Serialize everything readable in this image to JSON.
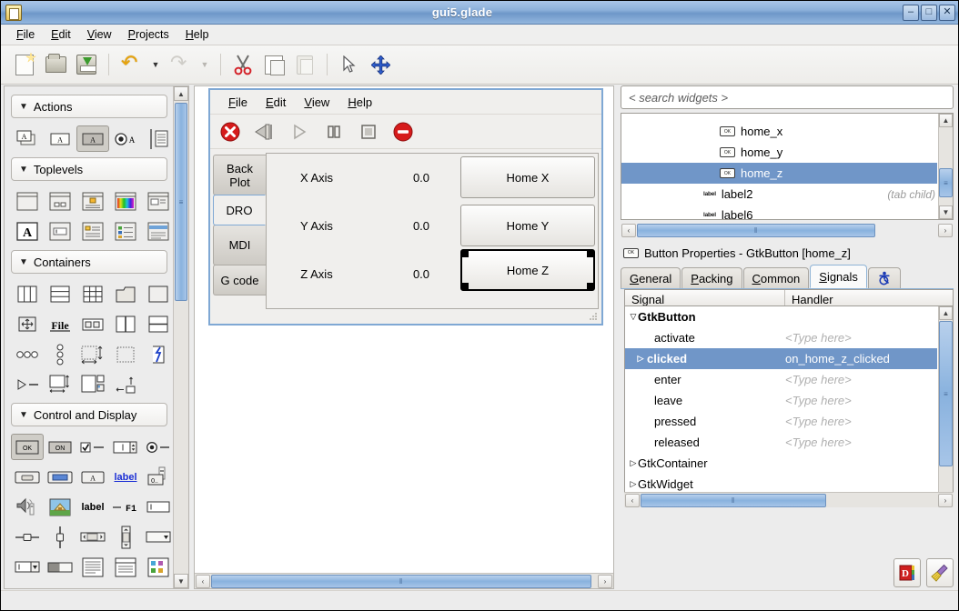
{
  "window": {
    "title": "gui5.glade",
    "icon": "glade-file-icon",
    "controls": {
      "minimize": "–",
      "maximize": "□",
      "close": "✕"
    }
  },
  "menubar": {
    "items": [
      {
        "label": "File",
        "mnemonic": "F"
      },
      {
        "label": "Edit",
        "mnemonic": "E"
      },
      {
        "label": "View",
        "mnemonic": "V"
      },
      {
        "label": "Projects",
        "mnemonic": "P"
      },
      {
        "label": "Help",
        "mnemonic": "H"
      }
    ]
  },
  "toolbar": {
    "buttons": [
      {
        "name": "new-project-icon",
        "title": "New"
      },
      {
        "name": "open-project-icon",
        "title": "Open"
      },
      {
        "name": "save-project-icon",
        "title": "Save"
      },
      {
        "name": "undo-icon",
        "title": "Undo"
      },
      {
        "name": "undo-dropdown-icon",
        "title": "Undo history"
      },
      {
        "name": "redo-icon",
        "title": "Redo"
      },
      {
        "name": "redo-dropdown-icon",
        "title": "Redo history"
      },
      {
        "name": "cut-icon",
        "title": "Cut"
      },
      {
        "name": "copy-icon",
        "title": "Copy"
      },
      {
        "name": "paste-icon",
        "title": "Paste"
      },
      {
        "name": "select-pointer-icon",
        "title": "Select"
      },
      {
        "name": "drag-resize-icon",
        "title": "Drag and Resize"
      }
    ]
  },
  "palette": {
    "groups": [
      {
        "label": "Actions",
        "expanded": true,
        "rows": [
          [
            {
              "name": "action-group-icon",
              "selected": false
            },
            {
              "name": "action-icon",
              "selected": false
            },
            {
              "name": "toggle-action-icon",
              "selected": true
            },
            {
              "name": "radio-action-icon",
              "selected": false
            },
            {
              "name": "recent-action-icon",
              "selected": false
            }
          ]
        ]
      },
      {
        "label": "Toplevels",
        "expanded": true,
        "rows": [
          [
            {
              "name": "window-icon",
              "selected": false
            },
            {
              "name": "dialog-icon",
              "selected": false
            },
            {
              "name": "message-dialog-icon",
              "selected": false
            },
            {
              "name": "color-selection-dialog-icon",
              "selected": false
            },
            {
              "name": "file-chooser-dialog-icon",
              "selected": false
            }
          ],
          [
            {
              "name": "font-selection-dialog-icon",
              "selected": false
            },
            {
              "name": "input-dialog-icon",
              "selected": false
            },
            {
              "name": "about-dialog-icon",
              "selected": false
            },
            {
              "name": "assistant-icon",
              "selected": false
            },
            {
              "name": "offscreen-window-icon",
              "selected": false
            }
          ]
        ]
      },
      {
        "label": "Containers",
        "expanded": true,
        "rows": [
          [
            {
              "name": "hbox-icon",
              "selected": false
            },
            {
              "name": "vbox-icon",
              "selected": false
            },
            {
              "name": "table-icon",
              "selected": false
            },
            {
              "name": "notebook-icon",
              "selected": false
            },
            {
              "name": "frame-icon",
              "selected": false
            }
          ],
          [
            {
              "name": "alignment-icon",
              "selected": false
            },
            {
              "name": "file-chooser-widget-icon",
              "selected": false
            },
            {
              "name": "hbutton-box-icon",
              "selected": false
            },
            {
              "name": "hpaned-icon",
              "selected": false
            },
            {
              "name": "vpaned-icon",
              "selected": false
            }
          ],
          [
            {
              "name": "vbutton-box-icon",
              "selected": false
            },
            {
              "name": "event-box-icon",
              "selected": false
            },
            {
              "name": "viewport-icon",
              "selected": false
            },
            {
              "name": "fixed-icon",
              "selected": false
            },
            {
              "name": "layout-icon",
              "selected": false
            }
          ],
          [
            {
              "name": "expander-icon",
              "selected": false
            },
            {
              "name": "scrolled-window-icon",
              "selected": false
            },
            {
              "name": "handle-box-icon",
              "selected": false
            },
            {
              "name": "toolbar-dock-icon",
              "selected": false
            },
            {
              "name": "spacer-icon",
              "selected": false
            }
          ]
        ]
      },
      {
        "label": "Control and Display",
        "expanded": true,
        "rows": [
          [
            {
              "name": "button-icon",
              "selected": true,
              "text": "OK"
            },
            {
              "name": "toggle-button-icon",
              "selected": false,
              "text": "ON"
            },
            {
              "name": "check-button-icon",
              "selected": false
            },
            {
              "name": "spin-button-icon",
              "selected": false
            },
            {
              "name": "radio-button-icon",
              "selected": false
            }
          ],
          [
            {
              "name": "file-chooser-button-icon",
              "selected": false
            },
            {
              "name": "color-button-icon",
              "selected": false
            },
            {
              "name": "font-button-icon",
              "selected": false
            },
            {
              "name": "link-button-icon",
              "selected": false,
              "text": "label"
            },
            {
              "name": "scale-button-icon",
              "selected": false,
              "text": "0.."
            }
          ],
          [
            {
              "name": "volume-button-icon",
              "selected": false
            },
            {
              "name": "image-icon",
              "selected": false
            },
            {
              "name": "label-icon",
              "selected": false,
              "text": "label"
            },
            {
              "name": "accel-label-icon",
              "selected": false,
              "text": "F1"
            },
            {
              "name": "entry-icon",
              "selected": false
            }
          ],
          [
            {
              "name": "hscale-icon",
              "selected": false
            },
            {
              "name": "vscale-icon",
              "selected": false
            },
            {
              "name": "hscrollbar-icon",
              "selected": false
            },
            {
              "name": "vscrollbar-icon",
              "selected": false
            },
            {
              "name": "combo-box-icon",
              "selected": false
            }
          ],
          [
            {
              "name": "combo-box-entry-icon",
              "selected": false
            },
            {
              "name": "progress-bar-icon",
              "selected": false
            },
            {
              "name": "text-view-icon",
              "selected": false
            },
            {
              "name": "tree-view-icon",
              "selected": false
            },
            {
              "name": "icon-view-icon",
              "selected": false
            }
          ],
          [
            {
              "name": "status-bar-icon",
              "selected": false
            },
            {
              "name": "toolbar-icon",
              "selected": false
            },
            {
              "name": "calendar-icon",
              "selected": false
            },
            {
              "name": "menu-bar-icon",
              "selected": false
            },
            {
              "name": "separator-icon",
              "selected": false
            }
          ]
        ]
      }
    ],
    "scrollbar": {
      "up": "▲",
      "down": "▼",
      "grip": "≡"
    }
  },
  "design": {
    "mock_window": {
      "menubar": [
        {
          "label": "File",
          "mnemonic": "F"
        },
        {
          "label": "Edit",
          "mnemonic": "E"
        },
        {
          "label": "View",
          "mnemonic": "V"
        },
        {
          "label": "Help",
          "mnemonic": "H"
        }
      ],
      "toolbar": [
        {
          "name": "estop-icon",
          "title": "E-Stop"
        },
        {
          "name": "machine-power-icon",
          "title": "Machine power"
        },
        {
          "name": "run-icon",
          "title": "Run"
        },
        {
          "name": "pause-icon",
          "title": "Pause"
        },
        {
          "name": "stop-icon",
          "title": "Stop"
        },
        {
          "name": "abort-icon",
          "title": "Abort"
        }
      ],
      "tabs": [
        {
          "label": "Back\nPlot",
          "label_line1": "Back",
          "label_line2": "Plot",
          "active": false
        },
        {
          "label": "DRO",
          "active": true
        },
        {
          "label": "MDI",
          "active": false
        },
        {
          "label": "G code",
          "active": false
        }
      ],
      "dro_rows": [
        {
          "axis": "X Axis",
          "value": "0.0",
          "button": "Home X",
          "selected": false
        },
        {
          "axis": "Y Axis",
          "value": "0.0",
          "button": "Home Y",
          "selected": false
        },
        {
          "axis": "Z Axis",
          "value": "0.0",
          "button": "Home Z",
          "selected": true
        }
      ]
    },
    "hscroll": {
      "left": "‹",
      "right": "›",
      "grip": "‖"
    }
  },
  "right_panel": {
    "search": {
      "placeholder": "< search widgets >",
      "value": "< search widgets >"
    },
    "widget_tree": {
      "rows": [
        {
          "icon": "button-tag-icon",
          "icon_text": "OK",
          "label": "home_x",
          "indent": 104,
          "selected": false,
          "note": ""
        },
        {
          "icon": "button-tag-icon",
          "icon_text": "OK",
          "label": "home_y",
          "indent": 104,
          "selected": false,
          "note": ""
        },
        {
          "icon": "button-tag-icon",
          "icon_text": "OK",
          "label": "home_z",
          "indent": 104,
          "selected": true,
          "note": ""
        },
        {
          "icon": "label-tag-icon",
          "icon_text": "label",
          "label": "label2",
          "indent": 86,
          "selected": false,
          "note": "(tab child)"
        },
        {
          "icon": "label-tag-icon",
          "icon_text": "label",
          "label": "label6",
          "indent": 86,
          "selected": false,
          "note": ""
        }
      ],
      "scroll": {
        "up": "▲",
        "down": "▼",
        "grip": "≡",
        "left": "‹",
        "right": "›",
        "hgrip": "‖"
      }
    },
    "properties": {
      "icon": "button-tag-icon",
      "icon_text": "OK",
      "title": "Button Properties - GtkButton [home_z]",
      "tabs": [
        {
          "label": "General",
          "mnemonic": "G",
          "active": false
        },
        {
          "label": "Packing",
          "mnemonic": "P",
          "active": false
        },
        {
          "label": "Common",
          "mnemonic": "C",
          "active": false
        },
        {
          "label": "Signals",
          "mnemonic": "S",
          "active": true
        },
        {
          "label": "",
          "name": "accessibility-icon",
          "active": false
        }
      ]
    },
    "signals": {
      "columns": {
        "signal": "Signal",
        "handler": "Handler"
      },
      "rows": [
        {
          "kind": "group",
          "expander": "▽",
          "signal": "GtkButton",
          "handler": "",
          "selected": false,
          "expanded": true
        },
        {
          "kind": "signal",
          "expander": "",
          "signal": "activate",
          "handler": "<Type here>",
          "empty": true,
          "selected": false
        },
        {
          "kind": "signal",
          "expander": "▷",
          "signal": "clicked",
          "handler": "on_home_z_clicked",
          "empty": false,
          "selected": true
        },
        {
          "kind": "signal",
          "expander": "",
          "signal": "enter",
          "handler": "<Type here>",
          "empty": true,
          "selected": false
        },
        {
          "kind": "signal",
          "expander": "",
          "signal": "leave",
          "handler": "<Type here>",
          "empty": true,
          "selected": false
        },
        {
          "kind": "signal",
          "expander": "",
          "signal": "pressed",
          "handler": "<Type here>",
          "empty": true,
          "selected": false
        },
        {
          "kind": "signal",
          "expander": "",
          "signal": "released",
          "handler": "<Type here>",
          "empty": true,
          "selected": false
        },
        {
          "kind": "group",
          "expander": "▷",
          "signal": "GtkContainer",
          "handler": "",
          "selected": false,
          "expanded": false
        },
        {
          "kind": "group",
          "expander": "▷",
          "signal": "GtkWidget",
          "handler": "",
          "selected": false,
          "expanded": false
        }
      ],
      "scroll": {
        "up": "▲",
        "down": "▼",
        "grip": "≡",
        "left": "‹",
        "right": "›",
        "hgrip": "‖"
      }
    },
    "bottom_buttons": [
      {
        "name": "devhelp-icon",
        "title": "Devhelp documentation"
      },
      {
        "name": "clear-broom-icon",
        "title": "Clear"
      }
    ]
  },
  "colors": {
    "titlebar_blue": "#8cb0da",
    "selection_blue": "#7096c8",
    "panel_bg": "#ececec",
    "design_border_blue": "#7fa8d4",
    "scrollbar_blue": "#89b2de"
  }
}
